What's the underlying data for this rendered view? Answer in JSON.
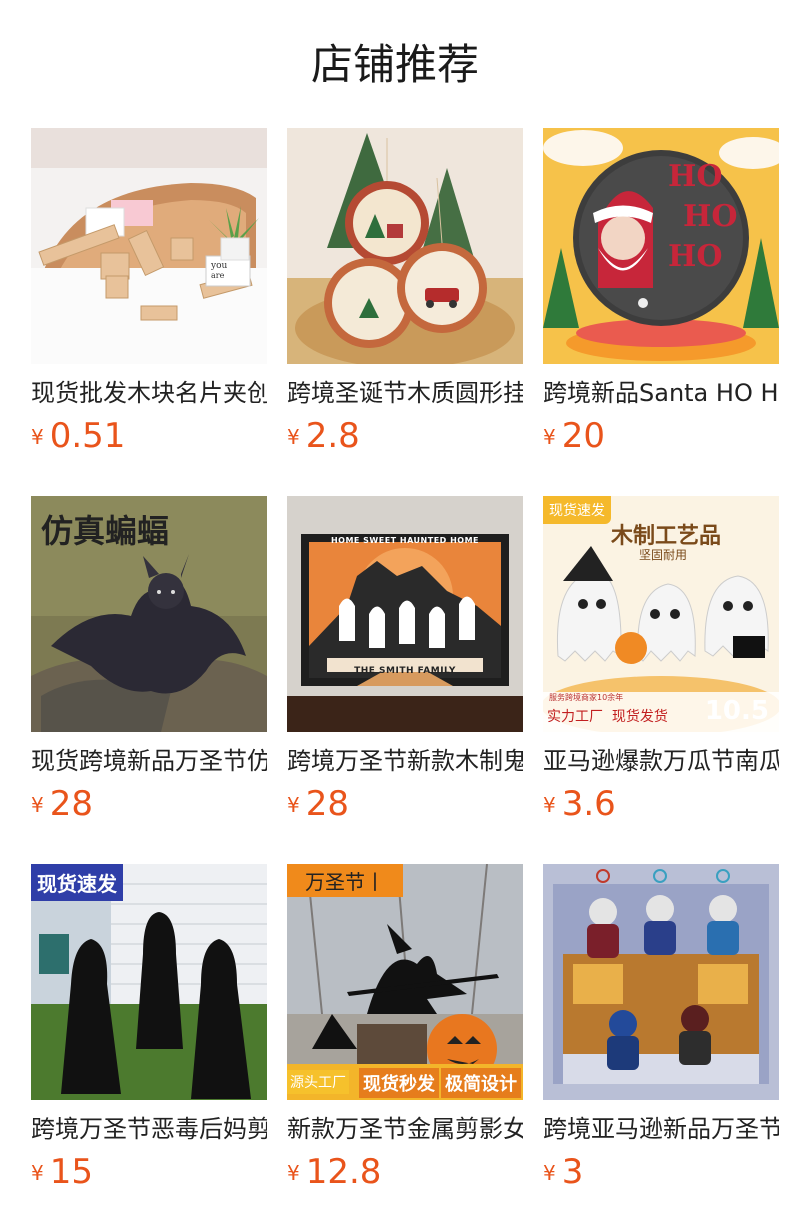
{
  "header": {
    "title": "店铺推荐"
  },
  "colors": {
    "price": "#e9541b"
  },
  "products": [
    {
      "name": "现货批发木块名片夹创意木质桌面摆件",
      "currency": "¥",
      "price": "0.51",
      "image": "wooden-card-holders-image"
    },
    {
      "name": "跨境圣诞节木质圆形挂件装饰品",
      "currency": "¥",
      "price": "2.8",
      "image": "christmas-wood-ornaments-image"
    },
    {
      "name": "跨境新品Santa HO HO HO圣诞挂牌",
      "currency": "¥",
      "price": "20",
      "image": "santa-hohoho-sign-image"
    },
    {
      "name": "现货跨境新品万圣节仿真蝙蝠毛绒玩具",
      "currency": "¥",
      "price": "28",
      "image": "plush-bat-image",
      "overlay": "仿真蝙蝠"
    },
    {
      "name": "跨境万圣节新款木制鬼屋摆件",
      "currency": "¥",
      "price": "28",
      "image": "haunted-home-sign-image",
      "overlay_top": "HOME SWEET HAUNTED HOME",
      "overlay_bottom": "THE SMITH FAMILY"
    },
    {
      "name": "亚马逊爆款万瓜节南瓜幽灵木制摆件",
      "currency": "¥",
      "price": "3.6",
      "image": "ghost-crafts-image",
      "badge": "现货速发",
      "headline": "木制工艺品",
      "subline": "坚固耐用",
      "small": "服务跨境商家10余年",
      "tags": "实力工厂  现货发货",
      "corner": "10.5"
    },
    {
      "name": "跨境万圣节恶毒后妈剪影地插装饰",
      "currency": "¥",
      "price": "15",
      "image": "witch-silhouettes-image",
      "badge": "现货速发"
    },
    {
      "name": "新款万圣节金属剪影女巫地插",
      "currency": "¥",
      "price": "12.8",
      "image": "metal-witch-silhouette-image",
      "badge": "万圣节丨",
      "tag1": "源头工厂",
      "tag2": "现货秒发",
      "tag3": "极简设计"
    },
    {
      "name": "跨境亚马逊新品万圣节亚克力挂件",
      "currency": "¥",
      "price": "3",
      "image": "acrylic-keychains-image"
    }
  ]
}
